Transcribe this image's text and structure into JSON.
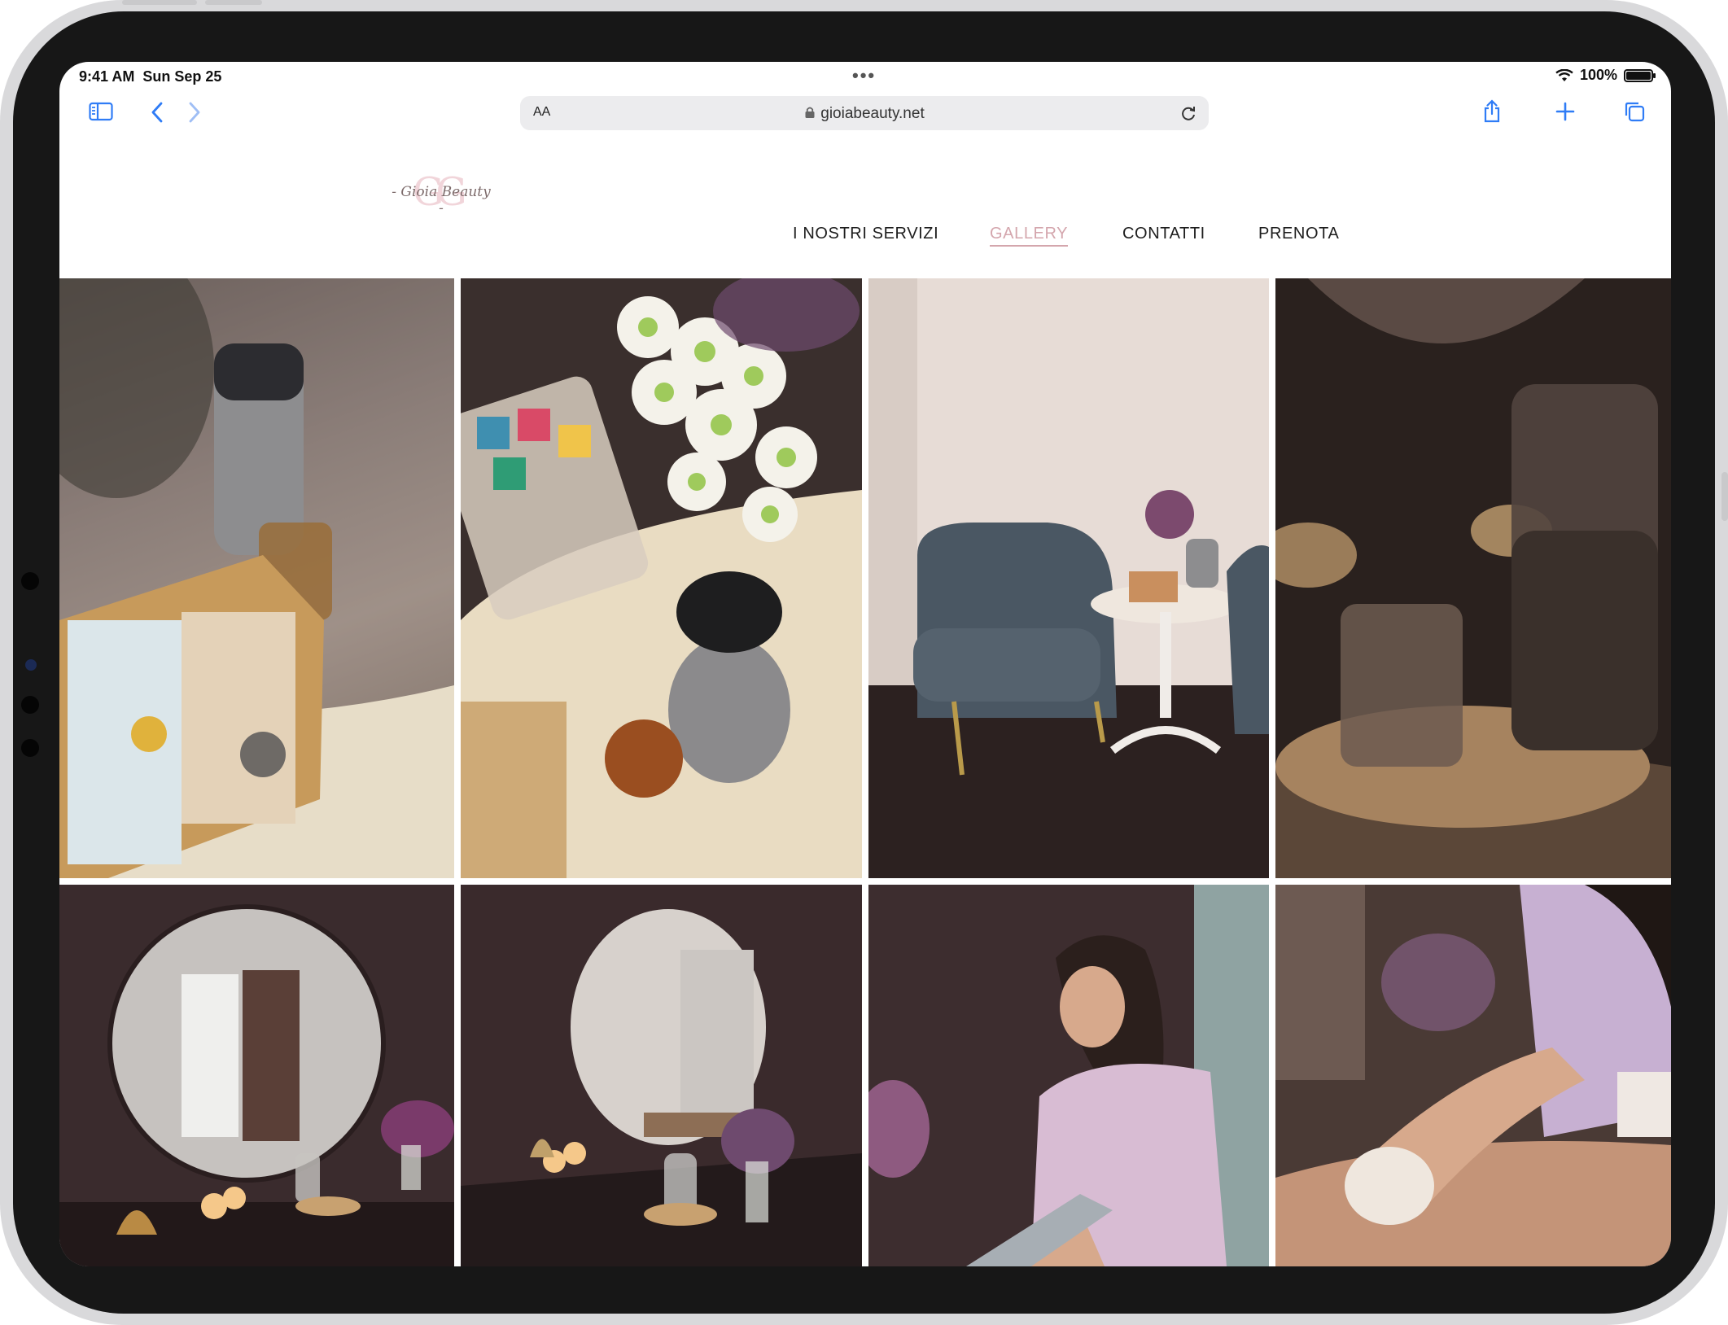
{
  "status_bar": {
    "time": "9:41 AM",
    "date": "Sun Sep 25",
    "battery": "100%"
  },
  "browser": {
    "text_size_label": "AA",
    "url": "gioiabeauty.net"
  },
  "site": {
    "logo_monogram": "GG",
    "logo_text": "- Gioia Beauty -",
    "nav": {
      "servizi": "I NOSTRI SERVIZI",
      "gallery": "GALLERY",
      "contatti": "CONTATTI",
      "prenota": "PRENOTA"
    },
    "active_nav": "GALLERY",
    "accent_color": "#d4a6ad"
  },
  "gallery": {
    "photos": [
      "tea-station-photo",
      "flowers-tea-table-photo",
      "waiting-chair-photo",
      "candles-carafe-photo",
      "round-mirror-candles-photo",
      "mirror-vanity-photo",
      "beautician-working-photo",
      "massage-treatment-photo"
    ]
  }
}
